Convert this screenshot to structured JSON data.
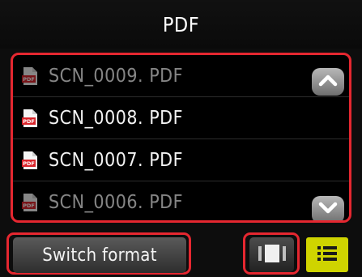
{
  "header": {
    "title": "PDF"
  },
  "file_list": {
    "items": [
      {
        "name": "SCN_0009. PDF",
        "icon": "pdf-file-icon"
      },
      {
        "name": "SCN_0008. PDF",
        "icon": "pdf-file-icon"
      },
      {
        "name": "SCN_0007. PDF",
        "icon": "pdf-file-icon"
      },
      {
        "name": "SCN_0006. PDF",
        "icon": "pdf-file-icon"
      }
    ],
    "scroll_up_icon": "chevron-up-icon",
    "scroll_down_icon": "chevron-down-icon"
  },
  "footer": {
    "switch_format_label": "Switch format",
    "single_view_icon": "single-view-icon",
    "list_view_icon": "list-view-icon"
  },
  "colors": {
    "highlight": "#e52730",
    "active_view": "#cfd400",
    "background": "#0d0d0d"
  }
}
